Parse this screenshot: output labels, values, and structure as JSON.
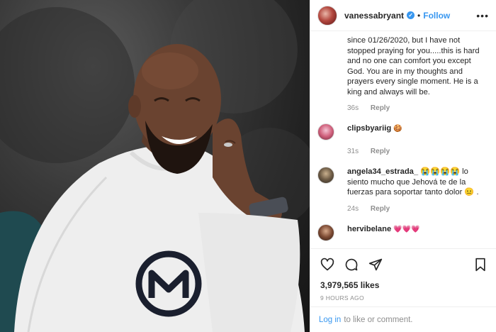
{
  "header": {
    "username": "vanessabryant",
    "follow_label": "Follow",
    "separator": "•",
    "more_label": "•••"
  },
  "comments": {
    "continued_text": "since 01/26/2020, but I have not stopped praying for you.....this is hard and no one can comfort you except God. You are in my thoughts and prayers every single moment. He is a king and always will be.",
    "continued_time": "36s",
    "reply_label": "Reply",
    "items": [
      {
        "user": "clipsbyariig",
        "text": "🍪",
        "time": "31s"
      },
      {
        "user": "angela34_estrada_",
        "text": "😭😭😭😭 lo siento mucho que Jehová te de la fuerzas para soportar tanto dolor 😐 .",
        "time": "24s"
      },
      {
        "user": "hervibelane",
        "text": "💗💗💗"
      }
    ]
  },
  "actions": {
    "likes": "3,979,565 likes",
    "time_ago": "9 HOURS AGO"
  },
  "footer": {
    "login_link": "Log in",
    "login_suffix": "to like or comment."
  },
  "icons": [
    "heart-icon",
    "comment-icon",
    "share-icon",
    "bookmark-icon",
    "verified-badge-icon"
  ],
  "colors": {
    "link_blue": "#3897f0",
    "muted": "#8e8e8e",
    "text": "#262626"
  }
}
